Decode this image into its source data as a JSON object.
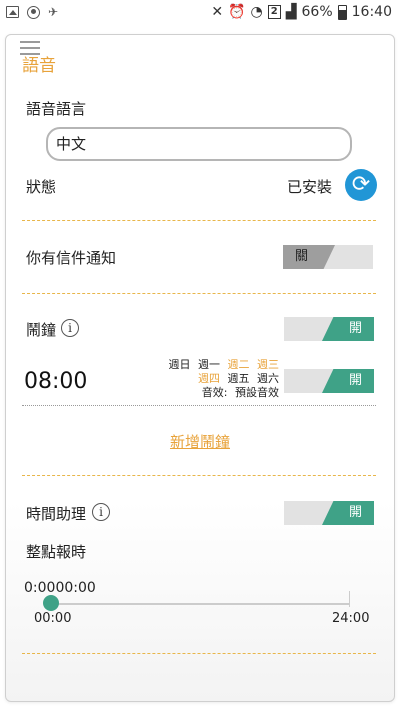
{
  "status_bar": {
    "battery": "66%",
    "time": "16:40",
    "sim_badge": "2"
  },
  "page": {
    "section_title": "語音",
    "voice_language_label": "語音語言",
    "voice_language_value": "中文",
    "status_label": "狀態",
    "status_value": "已安裝",
    "mail_notify_label": "你有信件通知",
    "mail_notify_toggle": "關",
    "alarm_label": "鬧鐘",
    "alarm_toggle": "開",
    "alarm": {
      "time": "08:00",
      "days_row1": [
        "週日",
        "週一",
        "週二",
        "週三"
      ],
      "days_row2": [
        "週四",
        "週五",
        "週六"
      ],
      "sound_label": "音效:",
      "sound_value": "預設音效",
      "toggle": "開"
    },
    "add_alarm_link": "新增鬧鐘",
    "time_assistant_label": "時間助理",
    "time_assistant_toggle": "開",
    "hourly_chime_label": "整點報時",
    "slider_value": "0:0000:00",
    "slider_level": 0,
    "slider_min": "00:00",
    "slider_max": "24:00",
    "info_glyph": "i"
  },
  "icons": {
    "refresh": "refresh-icon",
    "menu": "hamburger-icon",
    "info": "info-icon"
  },
  "colors": {
    "accent": "#e8a33b",
    "toggle_on": "#3fa287",
    "toggle_off": "#9e9e9e",
    "refresh_button": "#2196d6"
  }
}
